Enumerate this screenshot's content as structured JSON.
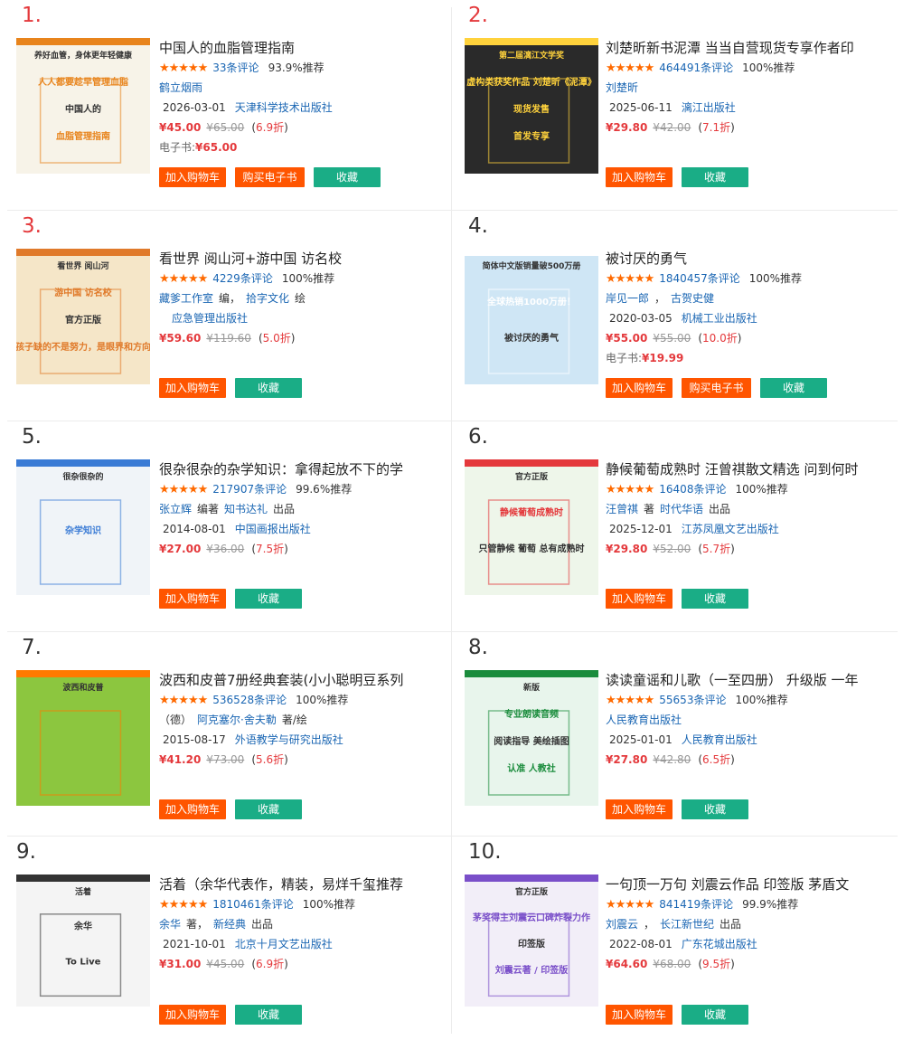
{
  "books": [
    {
      "rank": "1.",
      "title": "中国人的血脂管理指南",
      "reviews": "33条评论",
      "recommend": "93.9%推荐",
      "authors": [
        {
          "text": "鹤立烟雨",
          "link": true
        }
      ],
      "date": "2026-03-01",
      "publisher": "天津科学技术出版社",
      "price": "¥45.00",
      "orig": "¥65.00",
      "discount": "6.9折",
      "ebook_label": "电子书:",
      "ebook_price": "¥65.00",
      "buttons": [
        "加入购物车",
        "购买电子书",
        "收藏"
      ],
      "cover": {
        "bg": "#f7f3e8",
        "accent": "#e8841c",
        "lines": [
          "养好血管，身体更年轻健康",
          "人人都要趁早管理血脂",
          "中国人的",
          "血脂管理指南"
        ]
      }
    },
    {
      "rank": "2.",
      "title": "刘楚昕新书泥潭 当当自营现货专享作者印",
      "reviews": "464491条评论",
      "recommend": "100%推荐",
      "authors": [
        {
          "text": "刘楚昕",
          "link": true
        }
      ],
      "date": "2025-06-11",
      "publisher": "漓江出版社",
      "price": "¥29.80",
      "orig": "¥42.00",
      "discount": "7.1折",
      "buttons": [
        "加入购物车",
        "收藏"
      ],
      "cover": {
        "bg": "#2a2a2a",
        "accent": "#ffd23c",
        "lines": [
          "第二届漓江文学奖",
          "虚构类获奖作品 刘楚昕《泥潭》",
          "现货发售",
          "首发专享"
        ]
      }
    },
    {
      "rank": "3.",
      "title": "看世界 阅山河+游中国 访名校",
      "reviews": "4229条评论",
      "recommend": "100%推荐",
      "authors": [
        {
          "text": "藏爹工作室",
          "link": true
        },
        {
          "text": "编，",
          "link": false
        },
        {
          "text": "拾字文化",
          "link": true
        },
        {
          "text": "绘",
          "link": false
        }
      ],
      "authors2": [
        {
          "text": "应急管理出版社",
          "link": true
        }
      ],
      "price": "¥59.60",
      "orig": "¥119.60",
      "discount": "5.0折",
      "buttons": [
        "加入购物车",
        "收藏"
      ],
      "cover": {
        "bg": "#f5e6c8",
        "accent": "#e07a2a",
        "lines": [
          "看世界 阅山河",
          "游中国 访名校",
          "官方正版",
          "孩子缺的不是努力，是眼界和方向"
        ]
      }
    },
    {
      "rank": "4.",
      "title": "被讨厌的勇气",
      "reviews": "1840457条评论",
      "recommend": "100%推荐",
      "authors": [
        {
          "text": "岸见一郎",
          "link": true
        },
        {
          "text": "，",
          "link": false
        },
        {
          "text": "古贺史健",
          "link": true
        }
      ],
      "date": "2020-03-05",
      "publisher": "机械工业出版社",
      "price": "¥55.00",
      "orig": "¥55.00",
      "discount": "10.0折",
      "ebook_label": "电子书:",
      "ebook_price": "¥19.99",
      "buttons": [
        "加入购物车",
        "购买电子书",
        "收藏"
      ],
      "cover": {
        "bg": "#cfe6f5",
        "accent": "#ffffff",
        "lines": [
          "简体中文版销量破500万册",
          "全球热销1000万册！",
          "被讨厌的勇气"
        ]
      }
    },
    {
      "rank": "5.",
      "title": "很杂很杂的杂学知识：拿得起放不下的学",
      "reviews": "217907条评论",
      "recommend": "99.6%推荐",
      "authors": [
        {
          "text": "张立辉",
          "link": true
        },
        {
          "text": "编著",
          "link": false
        },
        {
          "text": "知书达礼",
          "link": true
        },
        {
          "text": "出品",
          "link": false
        }
      ],
      "date": "2014-08-01",
      "publisher": "中国画报出版社",
      "price": "¥27.00",
      "orig": "¥36.00",
      "discount": "7.5折",
      "buttons": [
        "加入购物车",
        "收藏"
      ],
      "cover": {
        "bg": "#f0f4f8",
        "accent": "#3a7bd5",
        "lines": [
          "很杂很杂的",
          "杂学知识"
        ]
      }
    },
    {
      "rank": "6.",
      "title": "静候葡萄成熟时 汪曾祺散文精选 问到何时",
      "reviews": "16408条评论",
      "recommend": "100%推荐",
      "authors": [
        {
          "text": "汪曾祺",
          "link": true
        },
        {
          "text": "著",
          "link": false
        },
        {
          "text": "时代华语",
          "link": true
        },
        {
          "text": "出品",
          "link": false
        }
      ],
      "date": "2025-12-01",
      "publisher": "江苏凤凰文艺出版社",
      "price": "¥29.80",
      "orig": "¥52.00",
      "discount": "5.7折",
      "buttons": [
        "加入购物车",
        "收藏"
      ],
      "cover": {
        "bg": "#eef6ea",
        "accent": "#e4393c",
        "lines": [
          "官方正版",
          "静候葡萄成熟时",
          "只管静候 葡萄 总有成熟时"
        ]
      }
    },
    {
      "rank": "7.",
      "title": "波西和皮普7册经典套装(小小聪明豆系列",
      "reviews": "536528条评论",
      "recommend": "100%推荐",
      "authors": [
        {
          "text": "（德）",
          "link": false
        },
        {
          "text": "阿克塞尔·舍夫勒",
          "link": true
        },
        {
          "text": "著/绘",
          "link": false
        }
      ],
      "date": "2015-08-17",
      "publisher": "外语教学与研究出版社",
      "price": "¥41.20",
      "orig": "¥73.00",
      "discount": "5.6折",
      "buttons": [
        "加入购物车",
        "收藏"
      ],
      "cover": {
        "bg": "#8cc63f",
        "accent": "#ff7a00",
        "lines": [
          "波西和皮普"
        ]
      }
    },
    {
      "rank": "8.",
      "title": "读读童谣和儿歌（一至四册） 升级版 一年",
      "reviews": "55653条评论",
      "recommend": "100%推荐",
      "authors": [
        {
          "text": "人民教育出版社",
          "link": true
        }
      ],
      "date": "2025-01-01",
      "publisher": "人民教育出版社",
      "price": "¥27.80",
      "orig": "¥42.80",
      "discount": "6.5折",
      "buttons": [
        "加入购物车",
        "收藏"
      ],
      "cover": {
        "bg": "#e8f5ec",
        "accent": "#1a8c3c",
        "lines": [
          "新版",
          "专业朗读音频",
          "阅读指导 美绘插图",
          "认准 人教社"
        ]
      }
    },
    {
      "rank": "9.",
      "title": "活着（余华代表作，精装，易烊千玺推荐",
      "reviews": "1810461条评论",
      "recommend": "100%推荐",
      "authors": [
        {
          "text": "余华",
          "link": true
        },
        {
          "text": "著，",
          "link": false
        },
        {
          "text": "新经典",
          "link": true
        },
        {
          "text": "出品",
          "link": false
        }
      ],
      "date": "2021-10-01",
      "publisher": "北京十月文艺出版社",
      "price": "¥31.00",
      "orig": "¥45.00",
      "discount": "6.9折",
      "buttons": [
        "加入购物车",
        "收藏"
      ],
      "cover": {
        "bg": "#f4f4f4",
        "accent": "#333333",
        "lines": [
          "活着",
          "余华",
          "To Live"
        ]
      }
    },
    {
      "rank": "10.",
      "title": "一句顶一万句 刘震云作品 印签版 茅盾文",
      "reviews": "841419条评论",
      "recommend": "99.9%推荐",
      "authors": [
        {
          "text": "刘震云",
          "link": true
        },
        {
          "text": "，",
          "link": false
        },
        {
          "text": "长江新世纪",
          "link": true
        },
        {
          "text": "出品",
          "link": false
        }
      ],
      "date": "2022-08-01",
      "publisher": "广东花城出版社",
      "price": "¥64.60",
      "orig": "¥68.00",
      "discount": "9.5折",
      "buttons": [
        "加入购物车",
        "收藏"
      ],
      "cover": {
        "bg": "#f2eef8",
        "accent": "#7a4fc9",
        "lines": [
          "官方正版",
          "茅奖得主刘震云口碑炸裂力作",
          "印签版",
          "刘震云著 / 印签版"
        ]
      }
    }
  ],
  "stars": "★★★★★",
  "colors": {
    "orange": "#ff5500",
    "green": "#1aad86",
    "red": "#e4393c",
    "blue": "#1a66b3"
  }
}
